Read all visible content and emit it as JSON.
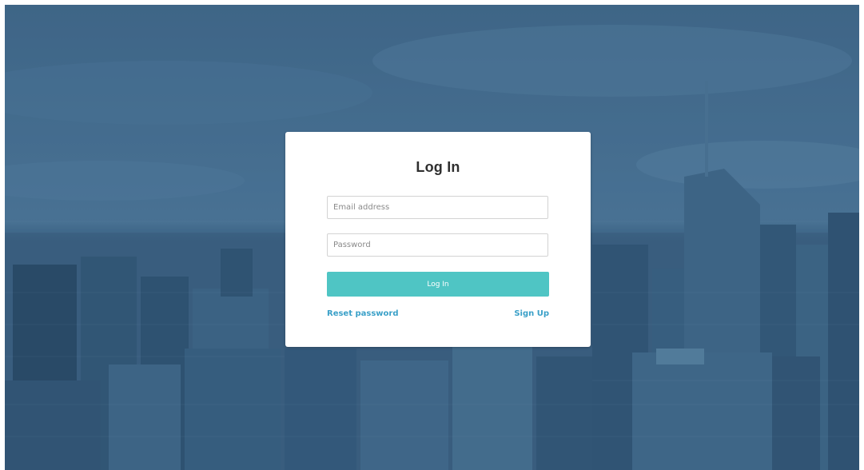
{
  "login_card": {
    "title": "Log In",
    "email_placeholder": "Email address",
    "password_placeholder": "Password",
    "submit_label": "Log In",
    "reset_label": "Reset password",
    "signup_label": "Sign Up"
  },
  "colors": {
    "background_tint": "#3f6a8d",
    "accent_button": "#4fc5c4",
    "link": "#3aa0c8",
    "card": "#ffffff"
  }
}
